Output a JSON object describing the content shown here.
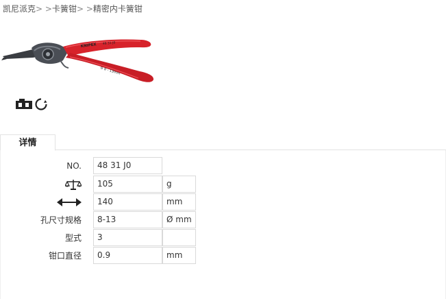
{
  "breadcrumb": {
    "items": [
      "凯尼派克",
      "卡簧钳",
      "精密内卡簧钳"
    ],
    "separator": "> >"
  },
  "product": {
    "image_icon": "pliers-image",
    "brand_text": "KNIPEX",
    "handle_marking": "48 31 J0",
    "handle_range": "8 - 13mm",
    "handle_color": "#d7232b"
  },
  "features": {
    "icons": [
      "chrome-vanadium-icon",
      "internal-circlip-icon"
    ]
  },
  "tab": {
    "label": "详情"
  },
  "specs": {
    "rows": [
      {
        "label": "NO.",
        "icon": "",
        "value": "48 31 J0",
        "unit": ""
      },
      {
        "label": "",
        "icon": "weight-scale-icon",
        "value": "105",
        "unit": "g"
      },
      {
        "label": "",
        "icon": "length-arrow-icon",
        "value": "140",
        "unit": "mm"
      },
      {
        "label": "孔尺寸规格",
        "icon": "",
        "value": "8-13",
        "unit": "Ø mm"
      },
      {
        "label": "型式",
        "icon": "",
        "value": "3",
        "unit": ""
      },
      {
        "label": "钳口直径",
        "icon": "",
        "value": "0.9",
        "unit": "mm"
      }
    ]
  }
}
